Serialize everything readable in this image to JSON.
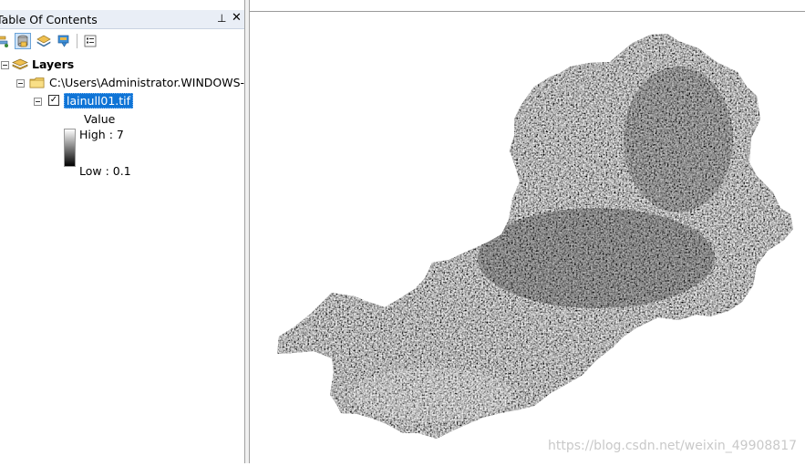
{
  "toc": {
    "title": "Table Of Contents",
    "pin_glyph": "⊥",
    "close_glyph": "✕",
    "toolbar": {
      "buttons": [
        {
          "name": "list-by-drawing-order",
          "icon": "drawing-order-icon"
        },
        {
          "name": "list-by-source",
          "icon": "database-icon"
        },
        {
          "name": "list-by-visibility",
          "icon": "layers-icon"
        },
        {
          "name": "list-by-selection",
          "icon": "selection-icon"
        },
        {
          "name": "options",
          "icon": "options-icon"
        }
      ]
    },
    "tree": {
      "root_label": "Layers",
      "folder_label": "C:\\Users\\Administrator.WINDOWS-C",
      "layer": {
        "label": "lainull01.tif",
        "checked": true,
        "check_glyph": "✓",
        "legend_heading": "Value",
        "high_label": "High : 7",
        "low_label": "Low : 0.1"
      }
    }
  },
  "map": {
    "raster": "grayscale-raster-region"
  },
  "watermark": "https://blog.csdn.net/weixin_49908817"
}
